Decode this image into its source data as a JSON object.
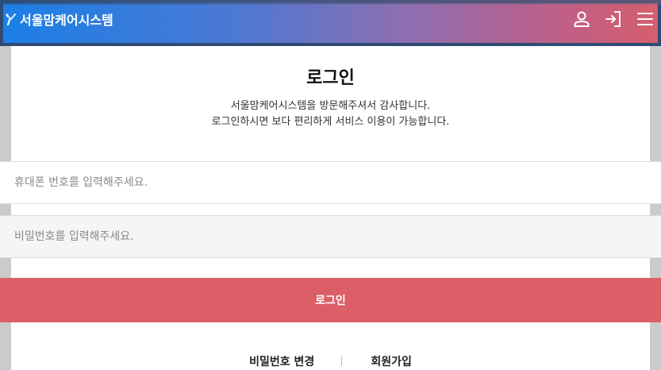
{
  "header": {
    "brand": "서울맘케어시스템",
    "icons": [
      "user-icon",
      "login-icon",
      "menu-icon"
    ]
  },
  "login": {
    "title": "로그인",
    "desc_line1": "서울맘케어시스템을 방문해주셔서 감사합니다.",
    "desc_line2": "로그인하시면 보다 편리하게 서비스 이용이 가능합니다.",
    "phone_placeholder": "휴대폰 번호를 입력해주세요.",
    "password_placeholder": "비밀번호를 입력해주세요.",
    "button_label": "로그인"
  },
  "links": {
    "change_password": "비밀번호 변경",
    "signup": "회원가입"
  },
  "colors": {
    "button": "#dc5f68",
    "header_start": "#1b7fe6",
    "header_end": "#d65f6c"
  }
}
